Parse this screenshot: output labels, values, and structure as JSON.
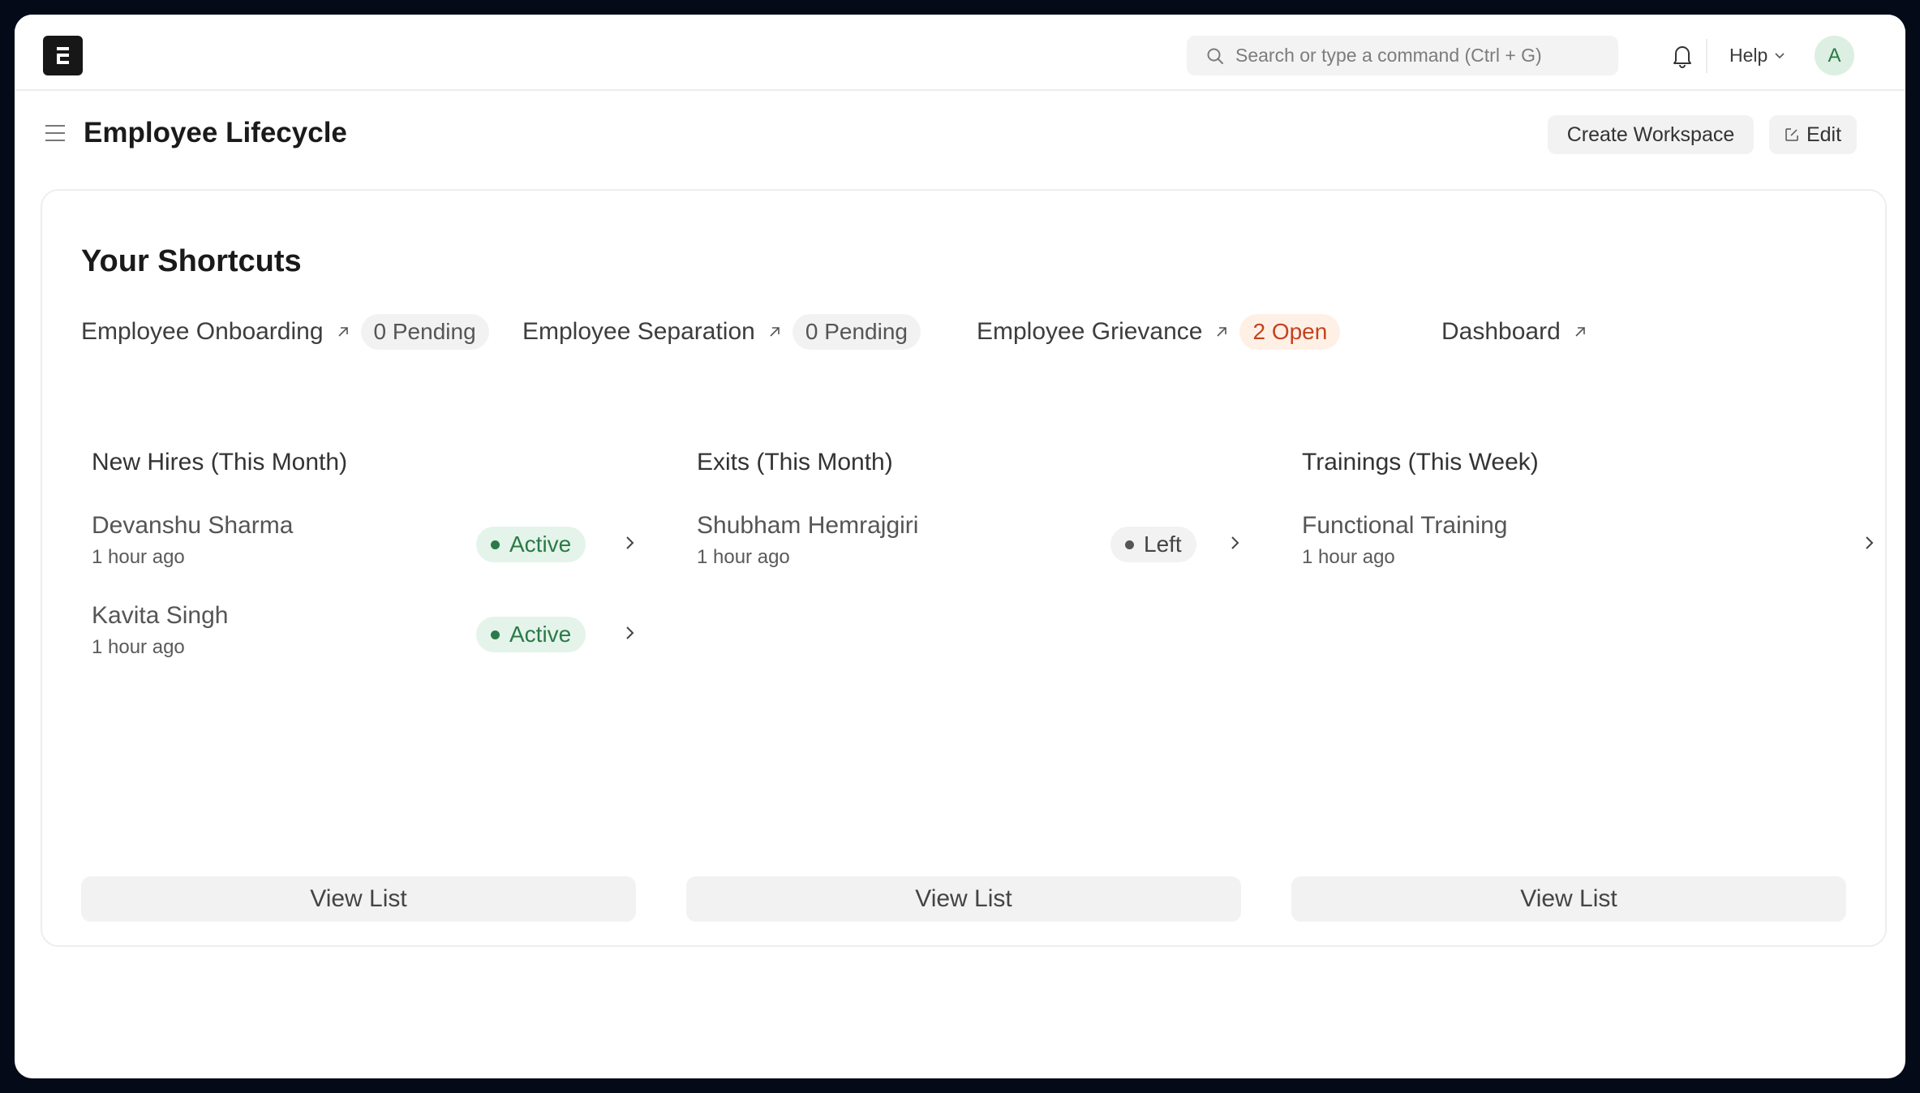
{
  "navbar": {
    "logo_letter": "E",
    "search_placeholder": "Search or type a command (Ctrl + G)",
    "help_label": "Help",
    "avatar_initial": "A"
  },
  "page": {
    "title": "Employee Lifecycle",
    "create_workspace_label": "Create Workspace",
    "edit_label": "Edit"
  },
  "shortcuts": {
    "title": "Your Shortcuts",
    "items": [
      {
        "label": "Employee Onboarding",
        "badge": "0 Pending",
        "badge_style": "grey"
      },
      {
        "label": "Employee Separation",
        "badge": "0 Pending",
        "badge_style": "grey"
      },
      {
        "label": "Employee Grievance",
        "badge": "2 Open",
        "badge_style": "orange"
      },
      {
        "label": "Dashboard",
        "badge": null
      }
    ]
  },
  "columns": [
    {
      "title": "New Hires (This Month)",
      "items": [
        {
          "name": "Devanshu Sharma",
          "time": "1 hour ago",
          "status": "Active"
        },
        {
          "name": "Kavita Singh",
          "time": "1 hour ago",
          "status": "Active"
        }
      ],
      "view_list_label": "View List"
    },
    {
      "title": "Exits (This Month)",
      "items": [
        {
          "name": "Shubham Hemrajgiri",
          "time": "1 hour ago",
          "status": "Left"
        }
      ],
      "view_list_label": "View List"
    },
    {
      "title": "Trainings (This Week)",
      "items": [
        {
          "name": "Functional Training",
          "time": "1 hour ago",
          "status": null
        }
      ],
      "view_list_label": "View List"
    }
  ],
  "colors": {
    "active_status": "#2b7a47",
    "open_badge": "#c4431f",
    "frame": "#040a18"
  }
}
